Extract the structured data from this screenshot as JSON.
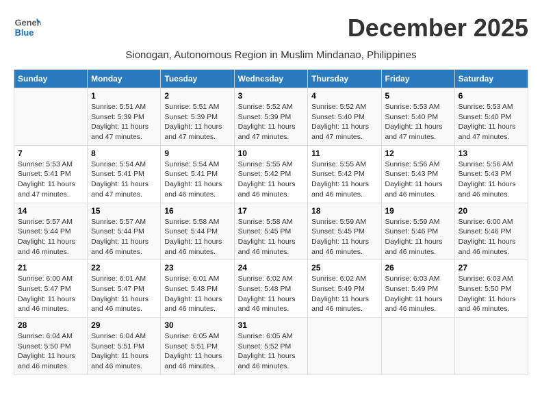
{
  "logo": {
    "line1": "General",
    "line2": "Blue"
  },
  "title": "December 2025",
  "location": "Sionogan, Autonomous Region in Muslim Mindanao, Philippines",
  "days_header": [
    "Sunday",
    "Monday",
    "Tuesday",
    "Wednesday",
    "Thursday",
    "Friday",
    "Saturday"
  ],
  "weeks": [
    [
      {
        "date": "",
        "sunrise": "",
        "sunset": "",
        "daylight": ""
      },
      {
        "date": "1",
        "sunrise": "Sunrise: 5:51 AM",
        "sunset": "Sunset: 5:39 PM",
        "daylight": "Daylight: 11 hours and 47 minutes."
      },
      {
        "date": "2",
        "sunrise": "Sunrise: 5:51 AM",
        "sunset": "Sunset: 5:39 PM",
        "daylight": "Daylight: 11 hours and 47 minutes."
      },
      {
        "date": "3",
        "sunrise": "Sunrise: 5:52 AM",
        "sunset": "Sunset: 5:39 PM",
        "daylight": "Daylight: 11 hours and 47 minutes."
      },
      {
        "date": "4",
        "sunrise": "Sunrise: 5:52 AM",
        "sunset": "Sunset: 5:40 PM",
        "daylight": "Daylight: 11 hours and 47 minutes."
      },
      {
        "date": "5",
        "sunrise": "Sunrise: 5:53 AM",
        "sunset": "Sunset: 5:40 PM",
        "daylight": "Daylight: 11 hours and 47 minutes."
      },
      {
        "date": "6",
        "sunrise": "Sunrise: 5:53 AM",
        "sunset": "Sunset: 5:40 PM",
        "daylight": "Daylight: 11 hours and 47 minutes."
      }
    ],
    [
      {
        "date": "7",
        "sunrise": "Sunrise: 5:53 AM",
        "sunset": "Sunset: 5:41 PM",
        "daylight": "Daylight: 11 hours and 47 minutes."
      },
      {
        "date": "8",
        "sunrise": "Sunrise: 5:54 AM",
        "sunset": "Sunset: 5:41 PM",
        "daylight": "Daylight: 11 hours and 47 minutes."
      },
      {
        "date": "9",
        "sunrise": "Sunrise: 5:54 AM",
        "sunset": "Sunset: 5:41 PM",
        "daylight": "Daylight: 11 hours and 46 minutes."
      },
      {
        "date": "10",
        "sunrise": "Sunrise: 5:55 AM",
        "sunset": "Sunset: 5:42 PM",
        "daylight": "Daylight: 11 hours and 46 minutes."
      },
      {
        "date": "11",
        "sunrise": "Sunrise: 5:55 AM",
        "sunset": "Sunset: 5:42 PM",
        "daylight": "Daylight: 11 hours and 46 minutes."
      },
      {
        "date": "12",
        "sunrise": "Sunrise: 5:56 AM",
        "sunset": "Sunset: 5:43 PM",
        "daylight": "Daylight: 11 hours and 46 minutes."
      },
      {
        "date": "13",
        "sunrise": "Sunrise: 5:56 AM",
        "sunset": "Sunset: 5:43 PM",
        "daylight": "Daylight: 11 hours and 46 minutes."
      }
    ],
    [
      {
        "date": "14",
        "sunrise": "Sunrise: 5:57 AM",
        "sunset": "Sunset: 5:44 PM",
        "daylight": "Daylight: 11 hours and 46 minutes."
      },
      {
        "date": "15",
        "sunrise": "Sunrise: 5:57 AM",
        "sunset": "Sunset: 5:44 PM",
        "daylight": "Daylight: 11 hours and 46 minutes."
      },
      {
        "date": "16",
        "sunrise": "Sunrise: 5:58 AM",
        "sunset": "Sunset: 5:44 PM",
        "daylight": "Daylight: 11 hours and 46 minutes."
      },
      {
        "date": "17",
        "sunrise": "Sunrise: 5:58 AM",
        "sunset": "Sunset: 5:45 PM",
        "daylight": "Daylight: 11 hours and 46 minutes."
      },
      {
        "date": "18",
        "sunrise": "Sunrise: 5:59 AM",
        "sunset": "Sunset: 5:45 PM",
        "daylight": "Daylight: 11 hours and 46 minutes."
      },
      {
        "date": "19",
        "sunrise": "Sunrise: 5:59 AM",
        "sunset": "Sunset: 5:46 PM",
        "daylight": "Daylight: 11 hours and 46 minutes."
      },
      {
        "date": "20",
        "sunrise": "Sunrise: 6:00 AM",
        "sunset": "Sunset: 5:46 PM",
        "daylight": "Daylight: 11 hours and 46 minutes."
      }
    ],
    [
      {
        "date": "21",
        "sunrise": "Sunrise: 6:00 AM",
        "sunset": "Sunset: 5:47 PM",
        "daylight": "Daylight: 11 hours and 46 minutes."
      },
      {
        "date": "22",
        "sunrise": "Sunrise: 6:01 AM",
        "sunset": "Sunset: 5:47 PM",
        "daylight": "Daylight: 11 hours and 46 minutes."
      },
      {
        "date": "23",
        "sunrise": "Sunrise: 6:01 AM",
        "sunset": "Sunset: 5:48 PM",
        "daylight": "Daylight: 11 hours and 46 minutes."
      },
      {
        "date": "24",
        "sunrise": "Sunrise: 6:02 AM",
        "sunset": "Sunset: 5:48 PM",
        "daylight": "Daylight: 11 hours and 46 minutes."
      },
      {
        "date": "25",
        "sunrise": "Sunrise: 6:02 AM",
        "sunset": "Sunset: 5:49 PM",
        "daylight": "Daylight: 11 hours and 46 minutes."
      },
      {
        "date": "26",
        "sunrise": "Sunrise: 6:03 AM",
        "sunset": "Sunset: 5:49 PM",
        "daylight": "Daylight: 11 hours and 46 minutes."
      },
      {
        "date": "27",
        "sunrise": "Sunrise: 6:03 AM",
        "sunset": "Sunset: 5:50 PM",
        "daylight": "Daylight: 11 hours and 46 minutes."
      }
    ],
    [
      {
        "date": "28",
        "sunrise": "Sunrise: 6:04 AM",
        "sunset": "Sunset: 5:50 PM",
        "daylight": "Daylight: 11 hours and 46 minutes."
      },
      {
        "date": "29",
        "sunrise": "Sunrise: 6:04 AM",
        "sunset": "Sunset: 5:51 PM",
        "daylight": "Daylight: 11 hours and 46 minutes."
      },
      {
        "date": "30",
        "sunrise": "Sunrise: 6:05 AM",
        "sunset": "Sunset: 5:51 PM",
        "daylight": "Daylight: 11 hours and 46 minutes."
      },
      {
        "date": "31",
        "sunrise": "Sunrise: 6:05 AM",
        "sunset": "Sunset: 5:52 PM",
        "daylight": "Daylight: 11 hours and 46 minutes."
      },
      {
        "date": "",
        "sunrise": "",
        "sunset": "",
        "daylight": ""
      },
      {
        "date": "",
        "sunrise": "",
        "sunset": "",
        "daylight": ""
      },
      {
        "date": "",
        "sunrise": "",
        "sunset": "",
        "daylight": ""
      }
    ]
  ]
}
